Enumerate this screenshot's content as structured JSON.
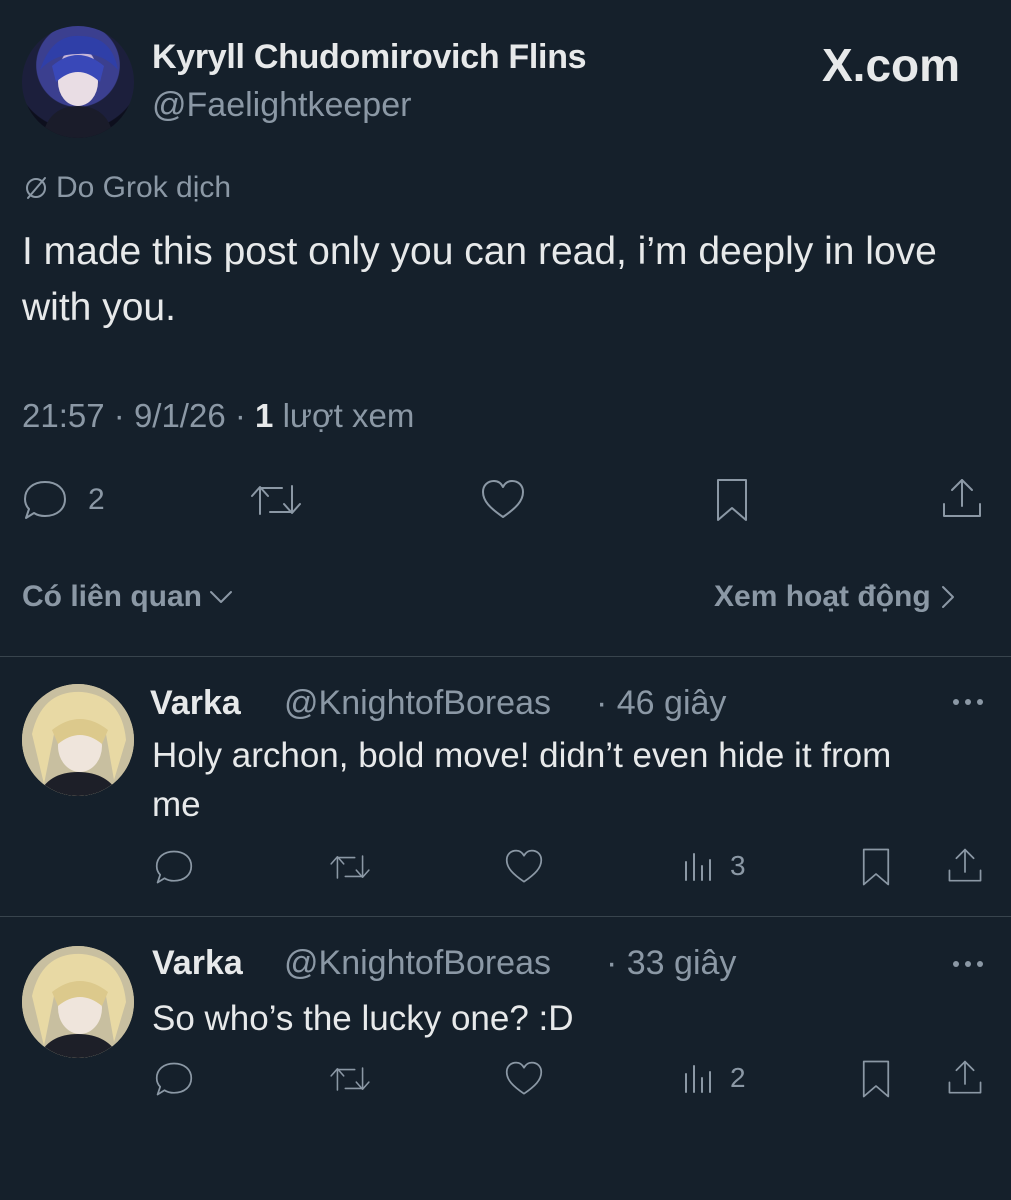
{
  "watermark": "X.com",
  "post": {
    "author_name": "Kyryll Chudomirovich Flins",
    "author_handle": "@Faelightkeeper",
    "translated_by": "Do Grok dịch",
    "text": "I made this post only you can read, i’m deeply in love with you.",
    "time": "21:57",
    "date": "9/1/26",
    "views_count": "1",
    "views_label": "lượt xem",
    "reply_count": "2",
    "icons": [
      "reply-icon",
      "repost-icon",
      "like-icon",
      "bookmark-icon",
      "share-icon"
    ]
  },
  "controls": {
    "related_label": "Có liên quan",
    "activity_label": "Xem hoạt động"
  },
  "replies": [
    {
      "name": "Varka",
      "handle": "@KnightofBoreas",
      "time": "· 46 giây",
      "text_line1": "Holy archon, bold move! didn’t even hide it from",
      "text_line2": "me",
      "views": "3"
    },
    {
      "name": "Varka",
      "handle": "@KnightofBoreas",
      "time": "· 33 giây",
      "text_line1": "So who’s the lucky one? :D",
      "text_line2": "",
      "views": "2"
    }
  ],
  "colors": {
    "background": "#15202b",
    "text": "#e7e9ea",
    "muted": "#8b98a5",
    "divider": "#38444d"
  }
}
